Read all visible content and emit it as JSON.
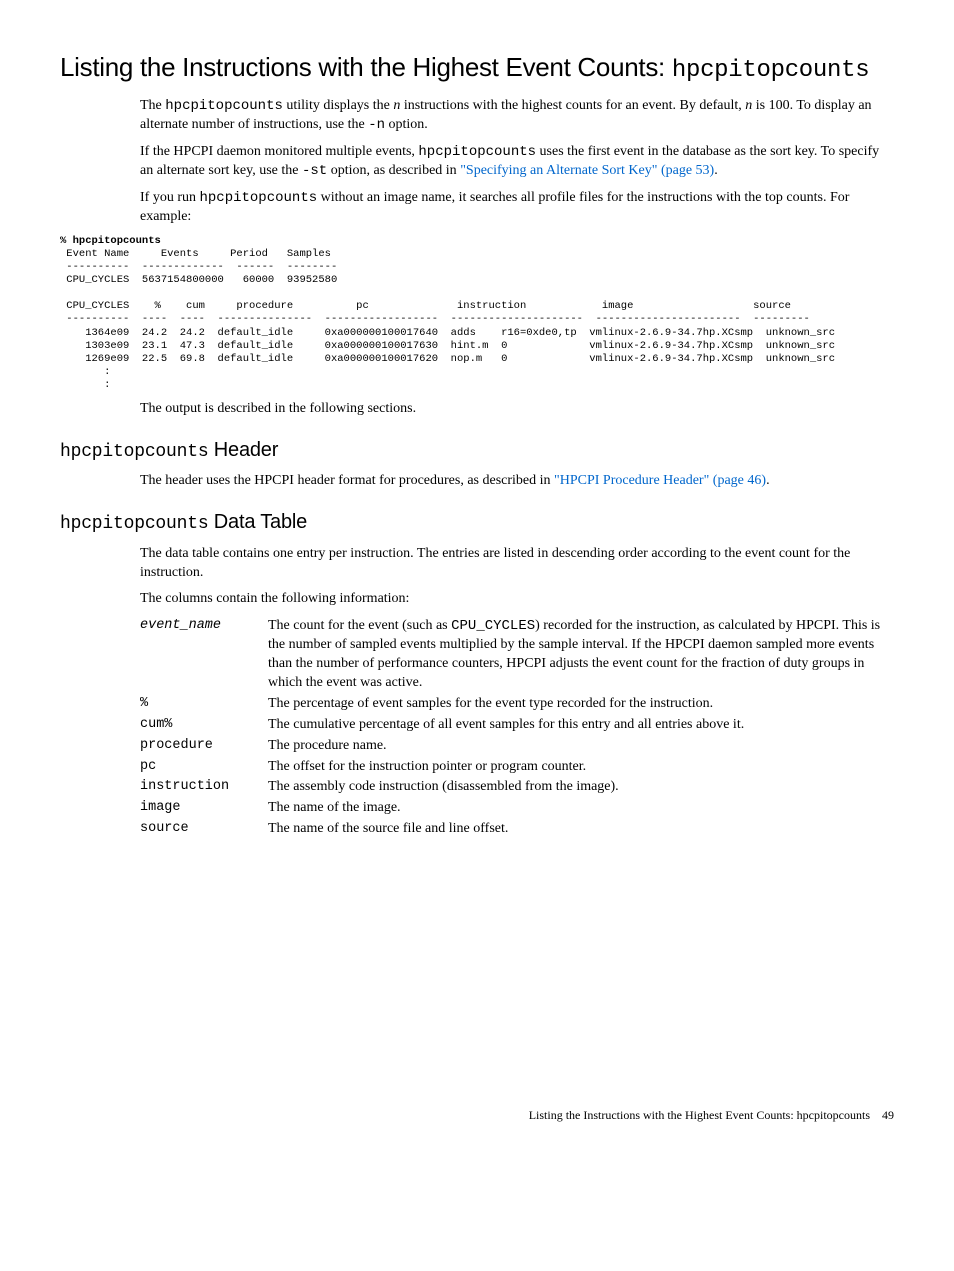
{
  "h1_prefix": "Listing the Instructions with the Highest Event Counts: ",
  "h1_mono": "hpcpitopcounts",
  "p1_a": "The ",
  "p1_mono1": "hpcpitopcounts",
  "p1_b": " utility displays the ",
  "p1_ital": "n",
  "p1_c": " instructions with the highest counts for an event. By default, ",
  "p1_ital2": "n",
  "p1_d": " is 100. To display an alternate number of instructions, use the ",
  "p1_mono2": "-n",
  "p1_e": " option.",
  "p2_a": "If the HPCPI daemon monitored multiple events, ",
  "p2_mono1": "hpcpitopcounts",
  "p2_b": " uses the first event in the database as the sort key. To specify an alternate sort key, use the ",
  "p2_mono2": " -st",
  "p2_c": " option, as described in ",
  "p2_link": "\"Specifying an Alternate Sort Key\" (page 53)",
  "p2_d": ".",
  "p3_a": "If you run ",
  "p3_mono1": "hpcpitopcounts",
  "p3_b": " without an image name, it searches all profile files for the instructions with the top counts. For example:",
  "code": {
    "cmd": "% hpcpitopcounts",
    "l1": " Event Name     Events     Period   Samples",
    "l2": " ----------  -------------  ------  --------",
    "l3": " CPU_CYCLES  5637154800000   60000  93952580",
    "l4": "",
    "l5": " CPU_CYCLES    %    cum     procedure          pc              instruction            image                   source",
    "l6": " ----------  ----  ----  ---------------  ------------------  ---------------------  -----------------------  ---------",
    "l7": "    1364e09  24.2  24.2  default_idle     0xa000000100017640  adds    r16=0xde0,tp  vmlinux-2.6.9-34.7hp.XCsmp  unknown_src",
    "l8": "    1303e09  23.1  47.3  default_idle     0xa000000100017630  hint.m  0             vmlinux-2.6.9-34.7hp.XCsmp  unknown_src",
    "l9": "    1269e09  22.5  69.8  default_idle     0xa000000100017620  nop.m   0             vmlinux-2.6.9-34.7hp.XCsmp  unknown_src",
    "l10": "       :",
    "l11": "       :"
  },
  "p4": "The output is described in the following sections.",
  "h2a_mono": "hpcpitopcounts",
  "h2a_rest": " Header",
  "p5_a": "The header uses the HPCPI header format for procedures, as described in ",
  "p5_link": "\"HPCPI Procedure Header\" (page 46)",
  "p5_b": ".",
  "h2b_mono": "hpcpitopcounts",
  "h2b_rest": " Data Table",
  "p6": "The data table contains one entry per instruction. The entries are listed in descending order according to the event count for the instruction.",
  "p7": "The columns contain the following information:",
  "defs": {
    "d0t": "event_name",
    "d0_a": "The count for the event (such as ",
    "d0_mono": "CPU_CYCLES",
    "d0_b": ") recorded for the instruction, as calculated by HPCPI. This is the number of sampled events multiplied by the sample interval. If the HPCPI daemon sampled more events than the number of performance counters, HPCPI adjusts the event count for the fraction of duty groups in which the event was active.",
    "d1t": "%",
    "d1": "The percentage of event samples for the event type recorded for the instruction.",
    "d2t": "cum%",
    "d2": "The cumulative percentage of all event samples for this entry and all entries above it.",
    "d3t": "procedure",
    "d3": "The procedure name.",
    "d4t": "pc",
    "d4": "The offset for the instruction pointer or program counter.",
    "d5t": "instruction",
    "d5": "The assembly code instruction (disassembled from the image).",
    "d6t": "image",
    "d6": "The name of the image.",
    "d7t": "source",
    "d7": "The name of the source file and line offset."
  },
  "footer_a": "Listing the Instructions with the Highest Event Counts: hpcpitopcounts",
  "footer_b": "49"
}
